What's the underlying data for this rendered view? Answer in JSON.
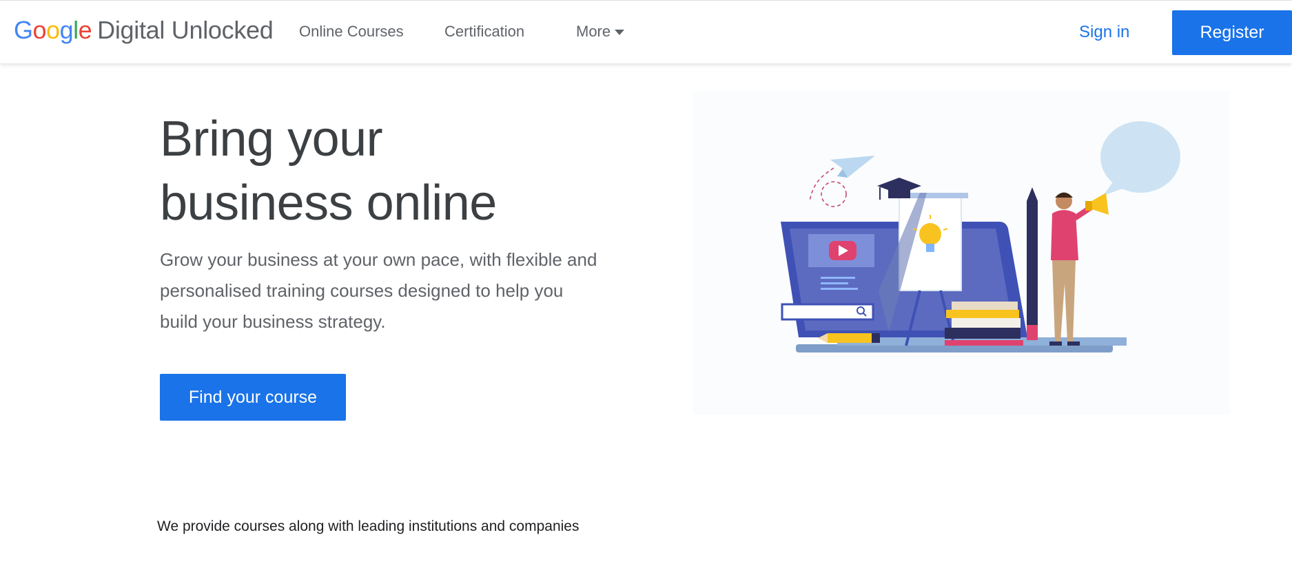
{
  "header": {
    "logo_google": "Google",
    "logo_rest": "Digital Unlocked",
    "nav": {
      "online_courses": "Online Courses",
      "certification": "Certification",
      "more": "More"
    },
    "sign_in": "Sign in",
    "register": "Register"
  },
  "hero": {
    "title_line1": "Bring your",
    "title_line2": "business online",
    "description": "Grow your business at your own pace, with flexible and personalised training courses designed to help you build your business strategy.",
    "cta": "Find your course",
    "illustration_search_placeholder": ""
  },
  "partners_text": "We provide courses along with leading institutions and companies",
  "colors": {
    "primary_blue": "#1a73e8",
    "text_dark": "#3c4043",
    "text_muted": "#5f6368",
    "illustration_blue": "#3f51b5",
    "illustration_pink": "#e91e63",
    "illustration_yellow": "#f9c31f",
    "speech_bubble": "#cde3f4"
  },
  "icons": {
    "caret": "chevron-down-icon",
    "play": "play-icon",
    "megaphone": "megaphone-icon",
    "lightbulb": "lightbulb-icon",
    "search": "search-icon"
  }
}
